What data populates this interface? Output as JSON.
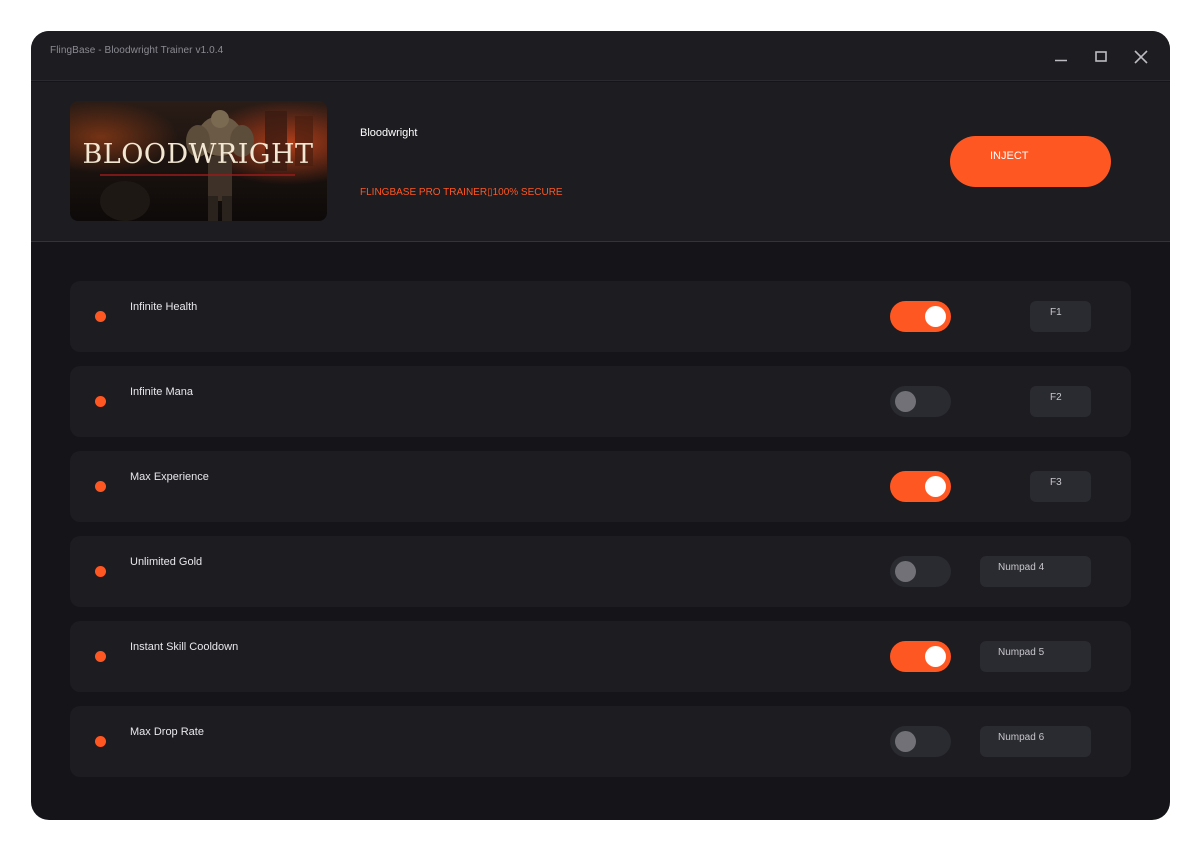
{
  "window": {
    "title": "FlingBase - Bloodwright Trainer v1.0.4"
  },
  "header": {
    "banner_text": "BLOODWRIGHT",
    "game_title": "Bloodwright",
    "subtitle": "FLINGBASE PRO TRAINER▯100% SECURE",
    "inject_label": "INJECT"
  },
  "colors": {
    "accent": "#ff5722",
    "background": "#141419",
    "panel": "#1d1c21",
    "control": "#2a2a31"
  },
  "cheats": [
    {
      "label": "Infinite Health",
      "enabled": true,
      "hotkey": "F1"
    },
    {
      "label": "Infinite Mana",
      "enabled": false,
      "hotkey": "F2"
    },
    {
      "label": "Max Experience",
      "enabled": true,
      "hotkey": "F3"
    },
    {
      "label": "Unlimited Gold",
      "enabled": false,
      "hotkey": "Numpad 4"
    },
    {
      "label": "Instant Skill Cooldown",
      "enabled": true,
      "hotkey": "Numpad 5"
    },
    {
      "label": "Max Drop Rate",
      "enabled": false,
      "hotkey": "Numpad 6"
    }
  ]
}
